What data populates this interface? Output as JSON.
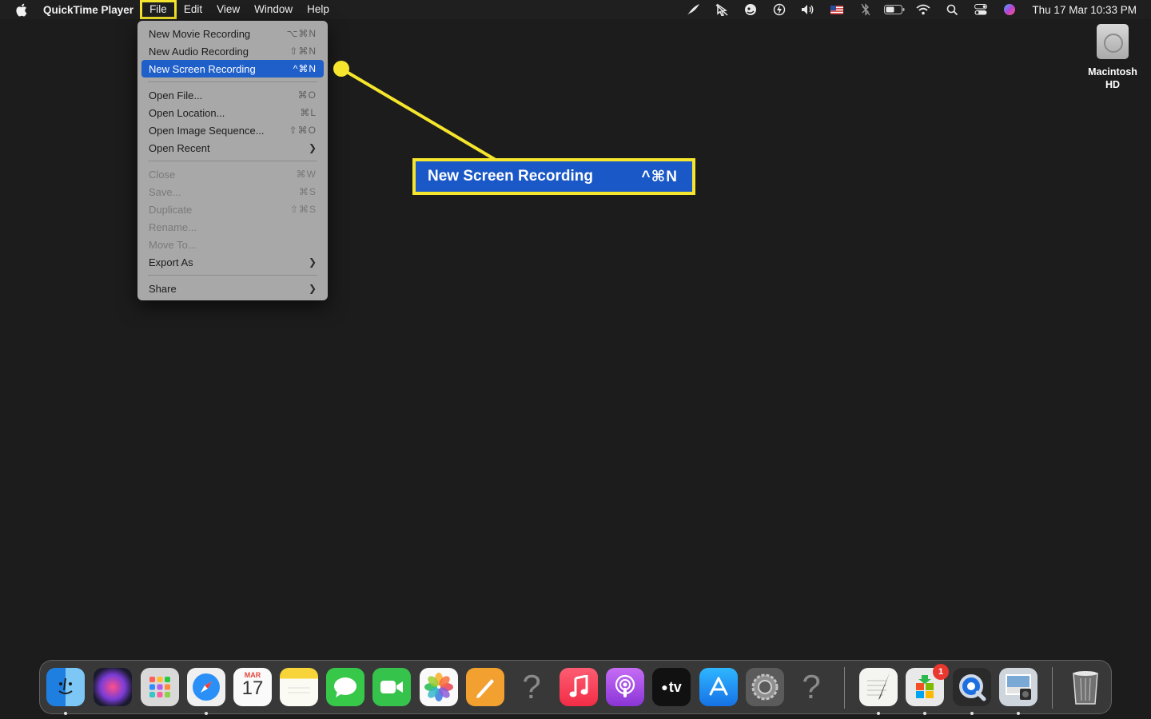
{
  "menubar": {
    "app_name": "QuickTime Player",
    "menus": [
      "File",
      "Edit",
      "View",
      "Window",
      "Help"
    ],
    "clock": "Thu 17 Mar  10:33 PM",
    "status_icons": [
      "feather-icon",
      "cursor-off-icon",
      "globe-face-icon",
      "bolt-icon",
      "volume-icon",
      "us-flag-icon",
      "bluetooth-icon",
      "battery-icon",
      "wifi-icon",
      "search-icon",
      "control-center-icon",
      "siri-icon"
    ]
  },
  "file_menu": {
    "groups": [
      [
        {
          "label": "New Movie Recording",
          "shortcut": "⌥⌘N",
          "enabled": true
        },
        {
          "label": "New Audio Recording",
          "shortcut": "⇧⌘N",
          "enabled": true
        },
        {
          "label": "New Screen Recording",
          "shortcut": "^⌘N",
          "enabled": true,
          "selected": true
        }
      ],
      [
        {
          "label": "Open File...",
          "shortcut": "⌘O",
          "enabled": true
        },
        {
          "label": "Open Location...",
          "shortcut": "⌘L",
          "enabled": true
        },
        {
          "label": "Open Image Sequence...",
          "shortcut": "⇧⌘O",
          "enabled": true
        },
        {
          "label": "Open Recent",
          "submenu": true,
          "enabled": true
        }
      ],
      [
        {
          "label": "Close",
          "shortcut": "⌘W",
          "enabled": false
        },
        {
          "label": "Save...",
          "shortcut": "⌘S",
          "enabled": false
        },
        {
          "label": "Duplicate",
          "shortcut": "⇧⌘S",
          "enabled": false
        },
        {
          "label": "Rename...",
          "enabled": false
        },
        {
          "label": "Move To...",
          "enabled": false
        },
        {
          "label": "Export As",
          "submenu": true,
          "enabled": true
        }
      ],
      [
        {
          "label": "Share",
          "submenu": true,
          "enabled": true
        }
      ]
    ]
  },
  "callout": {
    "label": "New Screen Recording",
    "shortcut": "^⌘N",
    "highlight_color": "#f5e52c"
  },
  "desktop": {
    "drive_label": "Macintosh HD"
  },
  "dock": {
    "calendar_month": "MAR",
    "calendar_day": "17",
    "tv_label": "tv",
    "badge_count": "1"
  }
}
